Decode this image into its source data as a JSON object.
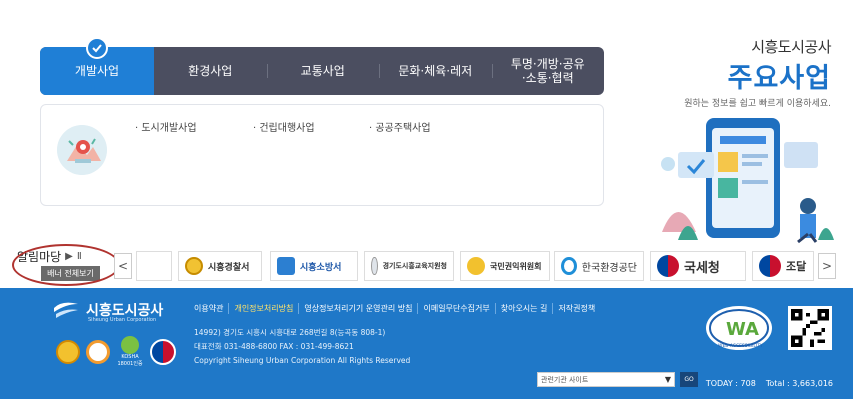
{
  "tabs": [
    {
      "label": "개발사업",
      "active": true
    },
    {
      "label": "환경사업"
    },
    {
      "label": "교통사업"
    },
    {
      "label": "문화·체육·레저"
    },
    {
      "label": "투명·개방·공유\n·소통·협력"
    }
  ],
  "content_links": [
    "· 도시개발사업",
    "· 건립대행사업",
    "· 공공주택사업"
  ],
  "header": {
    "org_name": "시흥도시공사",
    "title": "주요사업",
    "subtitle": "원하는 정보를 쉽고 빠르게 이용하세요."
  },
  "banner": {
    "label": "알림마당",
    "play": "▶",
    "pause": "Ⅱ",
    "view_all": "배너 전체보기",
    "prev": "<",
    "next": ">",
    "items": [
      "시흥경찰서",
      "시흥소방서",
      "경기도시흥교육지원청",
      "국민권익위원회",
      "한국환경공단",
      "국세청",
      "조달"
    ]
  },
  "footer": {
    "org_name": "시흥도시공사",
    "org_eng": "Siheung Urban Corporation",
    "links": [
      "이용약관",
      "개인정보처리방침",
      "영상정보처리기기 운영관리 방침",
      "이메일무단수집거부",
      "찾아오시는 길",
      "저작권정책"
    ],
    "address": "14992) 경기도 시흥시 시흥대로 268번길 8(능곡동 808-1)",
    "phone": "대표전화 031-488-6800 FAX : 031-499-8621",
    "copyright": "Copyright Siheung Urban Corporation All Rights Reserved",
    "select_value": "관련기관 사이트",
    "select_arrow": "▼",
    "go": "GO",
    "today": "TODAY : 708",
    "total": "Total : 3,663,016",
    "wa_text": "WEB ACCESSIBILITY",
    "kosha": "KOSHA 18001인증"
  },
  "colors": {
    "accent": "#1f7fd6",
    "tabbar": "#4b4e60",
    "footer": "#1f78c8",
    "title": "#1b72c8"
  }
}
